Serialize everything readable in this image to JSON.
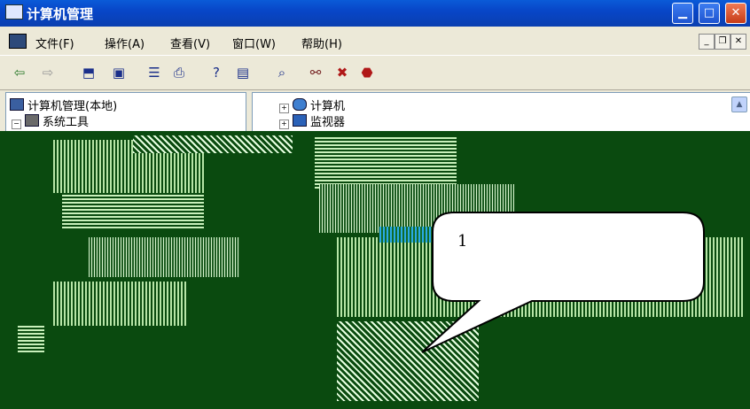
{
  "window": {
    "title": "计算机管理"
  },
  "menubar": {
    "items": [
      "文件(F)",
      "操作(A)",
      "查看(V)",
      "窗口(W)",
      "帮助(H)"
    ]
  },
  "toolbar": {
    "icons": [
      "back-arrow-icon",
      "forward-arrow-icon",
      "up-folder-icon",
      "show-tree-icon",
      "properties-icon",
      "print-icon",
      "help-icon",
      "export-list-icon",
      "scan-hardware-icon",
      "update-driver-icon",
      "disable-device-icon",
      "uninstall-device-icon"
    ]
  },
  "tree": {
    "root": "计算机管理(本地)",
    "system_tools": "系统工具"
  },
  "devices": {
    "items": [
      "计算机",
      "监视器"
    ]
  },
  "callout": {
    "label": "1"
  },
  "colors": {
    "title_bar": "#0a4fc8",
    "glitch_bg": "#0a4a0f",
    "glitch_noise": "#c9f0bb"
  }
}
